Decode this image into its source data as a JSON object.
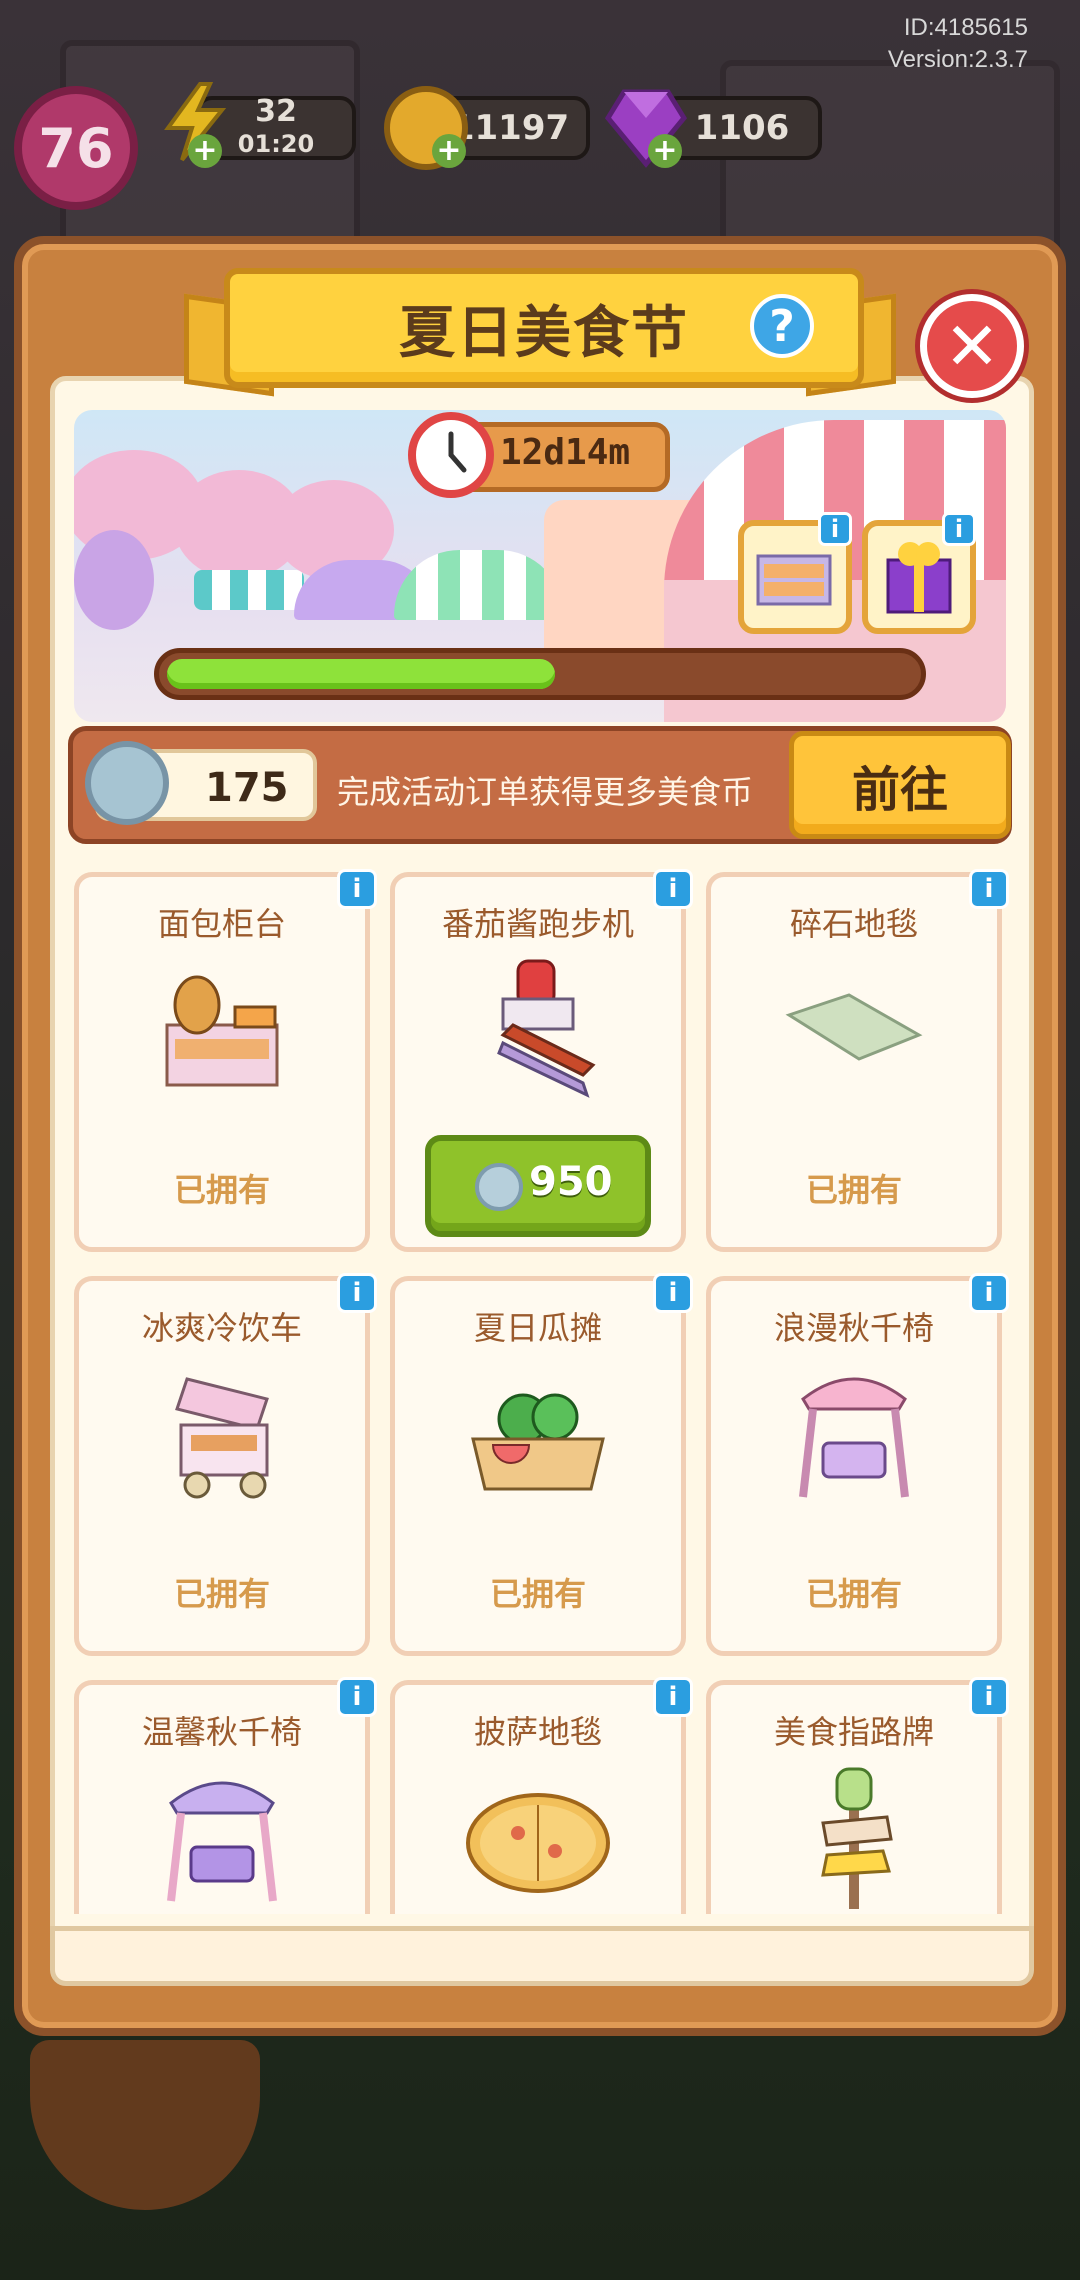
{
  "meta": {
    "id_text": "ID:4185615",
    "version_text": "Version:2.3.7"
  },
  "hud": {
    "level": "76",
    "energy": {
      "value": "32",
      "timer": "01:20",
      "icon": "lightning-icon"
    },
    "coins": {
      "value": "11197",
      "icon": "gold-coin-icon"
    },
    "gems": {
      "value": "1106",
      "icon": "purple-gem-icon"
    }
  },
  "dialog": {
    "title": "夏日美食节",
    "help_icon_label": "?",
    "close_icon_label": "✕",
    "timer": "12d14m",
    "progress_fraction": 0.52,
    "currency": {
      "count": "175",
      "description": "完成活动订单获得更多美食币",
      "go_label": "前往"
    },
    "items": [
      {
        "name": "面包柜台",
        "status": "已拥有",
        "art": "bread-counter"
      },
      {
        "name": "番茄酱跑步机",
        "status": "",
        "price": "950",
        "art": "ketchup-treadmill"
      },
      {
        "name": "碎石地毯",
        "status": "已拥有",
        "art": "gravel-rug"
      },
      {
        "name": "冰爽冷饮车",
        "status": "已拥有",
        "art": "drink-cart"
      },
      {
        "name": "夏日瓜摊",
        "status": "已拥有",
        "art": "melon-stall"
      },
      {
        "name": "浪漫秋千椅",
        "status": "已拥有",
        "art": "pink-swing"
      },
      {
        "name": "温馨秋千椅",
        "status": "",
        "art": "purple-swing"
      },
      {
        "name": "披萨地毯",
        "status": "",
        "art": "pizza-rug"
      },
      {
        "name": "美食指路牌",
        "status": "",
        "art": "food-signpost"
      }
    ]
  },
  "colors": {
    "dialog_frame": "#c8813f",
    "title_banner": "#ffd23f",
    "go_button": "#ffc43a",
    "buy_button": "#8fc22a",
    "progress_fill": "#8ee23a",
    "info_badge": "#2b9ee0"
  }
}
